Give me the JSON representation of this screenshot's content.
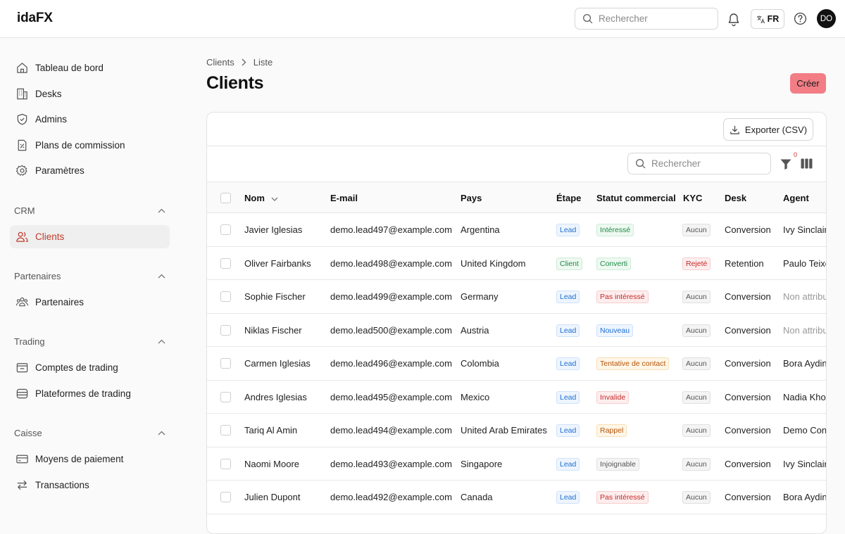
{
  "app": {
    "logo": "idaFX"
  },
  "topbar": {
    "search_placeholder": "Rechercher",
    "lang": "FR",
    "avatar": "DO"
  },
  "sidebar": {
    "main_items": [
      {
        "label": "Tableau de bord",
        "icon": "home-icon"
      },
      {
        "label": "Desks",
        "icon": "building-icon"
      },
      {
        "label": "Admins",
        "icon": "shield-icon"
      },
      {
        "label": "Plans de commission",
        "icon": "percent-doc-icon"
      },
      {
        "label": "Paramètres",
        "icon": "gear-icon"
      }
    ],
    "sections": [
      {
        "title": "CRM",
        "items": [
          {
            "label": "Clients",
            "icon": "users-icon",
            "active": true
          }
        ]
      },
      {
        "title": "Partenaires",
        "items": [
          {
            "label": "Partenaires",
            "icon": "group-icon"
          }
        ]
      },
      {
        "title": "Trading",
        "items": [
          {
            "label": "Comptes de trading",
            "icon": "wallet-icon"
          },
          {
            "label": "Plateformes de trading",
            "icon": "server-icon"
          }
        ]
      },
      {
        "title": "Caisse",
        "items": [
          {
            "label": "Moyens de paiement",
            "icon": "card-icon"
          },
          {
            "label": "Transactions",
            "icon": "arrows-icon"
          }
        ]
      }
    ]
  },
  "page": {
    "breadcrumb": [
      "Clients",
      "Liste"
    ],
    "title": "Clients",
    "create_label": "Créer",
    "export_label": "Exporter (CSV)",
    "table_search_placeholder": "Rechercher",
    "filter_count": "0"
  },
  "colors": {
    "accent": "#c0392b",
    "create_bg": "#f27d85"
  },
  "table": {
    "columns": [
      "Nom",
      "E-mail",
      "Pays",
      "Étape",
      "Statut commercial",
      "KYC",
      "Desk",
      "Agent"
    ],
    "rows": [
      {
        "nom": "Javier Iglesias",
        "email": "demo.lead497@example.com",
        "pays": "Argentina",
        "etape": "Lead",
        "statut": "Intéressé",
        "kyc": "Aucun",
        "desk": "Conversion",
        "agent": "Ivy Sinclair"
      },
      {
        "nom": "Oliver Fairbanks",
        "email": "demo.lead498@example.com",
        "pays": "United Kingdom",
        "etape": "Client",
        "statut": "Converti",
        "kyc": "Rejeté",
        "desk": "Retention",
        "agent": "Paulo Teixe"
      },
      {
        "nom": "Sophie Fischer",
        "email": "demo.lead499@example.com",
        "pays": "Germany",
        "etape": "Lead",
        "statut": "Pas intéressé",
        "kyc": "Aucun",
        "desk": "Conversion",
        "agent": "Non attribu"
      },
      {
        "nom": "Niklas Fischer",
        "email": "demo.lead500@example.com",
        "pays": "Austria",
        "etape": "Lead",
        "statut": "Nouveau",
        "kyc": "Aucun",
        "desk": "Conversion",
        "agent": "Non attribu"
      },
      {
        "nom": "Carmen Iglesias",
        "email": "demo.lead496@example.com",
        "pays": "Colombia",
        "etape": "Lead",
        "statut": "Tentative de contact",
        "kyc": "Aucun",
        "desk": "Conversion",
        "agent": "Bora Aydin"
      },
      {
        "nom": "Andres Iglesias",
        "email": "demo.lead495@example.com",
        "pays": "Mexico",
        "etape": "Lead",
        "statut": "Invalide",
        "kyc": "Aucun",
        "desk": "Conversion",
        "agent": "Nadia Khou"
      },
      {
        "nom": "Tariq Al Amin",
        "email": "demo.lead494@example.com",
        "pays": "United Arab Emirates",
        "etape": "Lead",
        "statut": "Rappel",
        "kyc": "Aucun",
        "desk": "Conversion",
        "agent": "Demo Conv"
      },
      {
        "nom": "Naomi Moore",
        "email": "demo.lead493@example.com",
        "pays": "Singapore",
        "etape": "Lead",
        "statut": "Injoignable",
        "kyc": "Aucun",
        "desk": "Conversion",
        "agent": "Ivy Sinclair"
      },
      {
        "nom": "Julien Dupont",
        "email": "demo.lead492@example.com",
        "pays": "Canada",
        "etape": "Lead",
        "statut": "Pas intéressé",
        "kyc": "Aucun",
        "desk": "Conversion",
        "agent": "Bora Aydin"
      }
    ]
  }
}
